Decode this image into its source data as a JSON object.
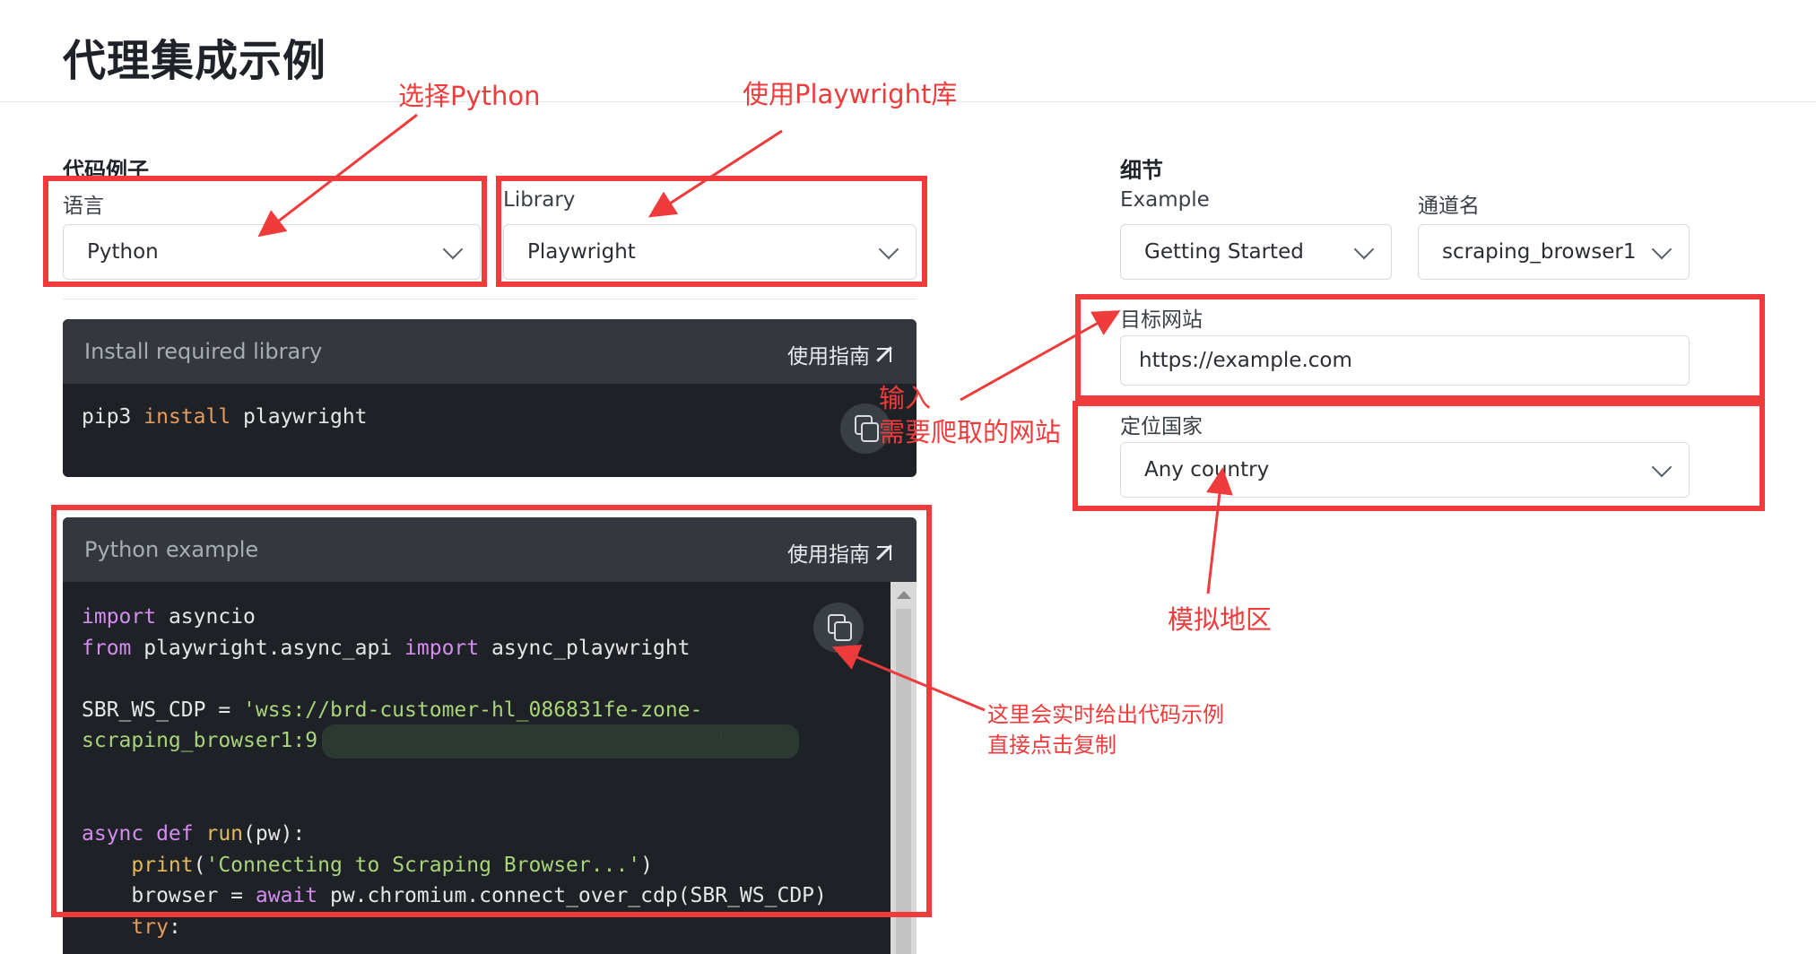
{
  "page": {
    "title": "代理集成示例"
  },
  "code_section": {
    "heading": "代码例子"
  },
  "language": {
    "label": "语言",
    "value": "Python"
  },
  "library": {
    "label": "Library",
    "value": "Playwright"
  },
  "install_panel": {
    "title": "Install required library",
    "guide": "使用指南",
    "command": [
      "pip3",
      "install",
      "playwright"
    ]
  },
  "example_panel": {
    "title": "Python example",
    "guide": "使用指南",
    "lines": {
      "l1a": "import",
      "l1b": " asyncio",
      "l2a": "from",
      "l2b": " playwright.async_api ",
      "l2c": "import",
      "l2d": " async_playwright",
      "l4a": "SBR_WS_CDP = ",
      "l4b": "'wss://brd-customer-hl_086831fe-zone-",
      "l5a": "scraping_browser1:9",
      "l5b": "'",
      "l8a": "async def ",
      "l8b": "run",
      "l8c": "(pw):",
      "l9a": "    print",
      "l9b": "(",
      "l9c": "'Connecting to Scraping Browser...'",
      "l9d": ")",
      "l10a": "    browser = ",
      "l10b": "await",
      "l10c": " pw.chromium.connect_over_cdp(SBR_WS_CDP)",
      "l11a": "    try",
      "l11b": ":"
    }
  },
  "details": {
    "heading": "细节",
    "example": {
      "label": "Example",
      "value": "Getting Started"
    },
    "channel": {
      "label": "通道名",
      "value": "scraping_browser1"
    },
    "target": {
      "label": "目标网站",
      "value": "https://example.com"
    },
    "country": {
      "label": "定位国家",
      "value": "Any country"
    }
  },
  "annotations": {
    "choose_python": "选择Python",
    "use_playwright": "使用Playwright库",
    "input_line1": "输入",
    "input_line2": "需要爬取的网站",
    "simulate_region": "模拟地区",
    "realtime_line1": "这里会实时给出代码示例",
    "realtime_line2": "直接点击复制"
  },
  "colors": {
    "annotation": "#ef3b3b",
    "code_bg": "#1e2126",
    "panel_head": "#34383e"
  }
}
